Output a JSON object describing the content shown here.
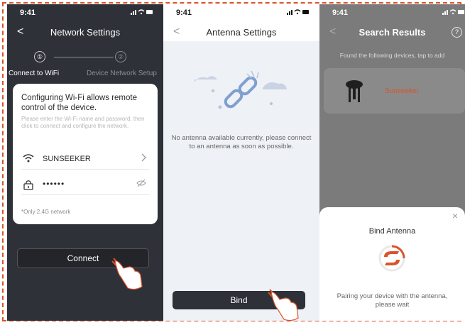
{
  "screen1": {
    "status": {
      "time": "9:41",
      "icons": "📶 ◔ ▬"
    },
    "nav": {
      "back": "<",
      "title": "Network Settings"
    },
    "steps": [
      {
        "number": "①",
        "label": "Connect to WiFi"
      },
      {
        "number": "②",
        "label": "Device Network Setup"
      }
    ],
    "card": {
      "heading": "Configuring Wi-Fi allows remote control of the device.",
      "subtext": "Please enter the Wi-Fi name and password, then click to connect and configure the network.",
      "wifi_name": "SUNSEEKER",
      "password": "••••••",
      "note": "*Only 2.4G network"
    },
    "connect_label": "Connect"
  },
  "screen2": {
    "status": {
      "time": "9:41",
      "icons": "📶 ◔ ▬"
    },
    "nav": {
      "back": "<",
      "title": "Antenna Settings"
    },
    "empty_message": "No antenna available currently, please connect to an antenna as soon as possible.",
    "bind_label": "Bind"
  },
  "screen3": {
    "status": {
      "time": "9:41",
      "icons": "📶 ◔ ▬"
    },
    "nav": {
      "back": "<",
      "title": "Search Results",
      "help": "?"
    },
    "found_text": "Found the following devices, tap to add",
    "device_name": "Sunseeker",
    "sheet": {
      "close": "×",
      "title": "Bind Antenna",
      "message": "Pairing your device with the antenna, please wait"
    }
  },
  "colors": {
    "brand": "#d9542b",
    "dark": "#2f3138",
    "frame": "#d9542b"
  }
}
